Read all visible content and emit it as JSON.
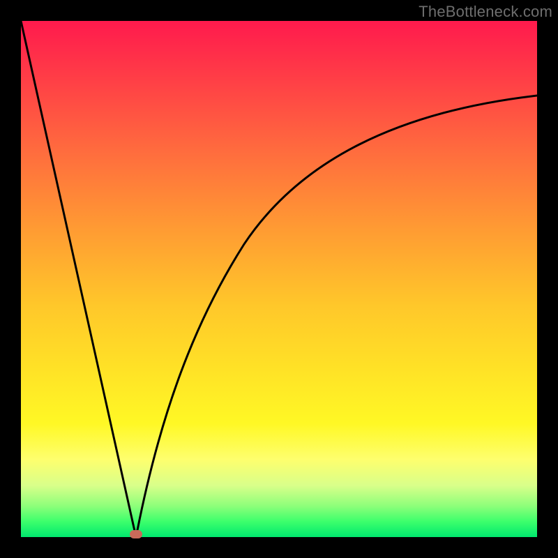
{
  "watermark": "TheBottleneck.com",
  "chart_data": {
    "type": "line",
    "title": "",
    "xlabel": "",
    "ylabel": "",
    "xlim": [
      0,
      100
    ],
    "ylim": [
      0,
      100
    ],
    "grid": false,
    "series": [
      {
        "name": "left-branch",
        "x": [
          0,
          22
        ],
        "y": [
          100,
          0
        ]
      },
      {
        "name": "right-branch",
        "x": [
          22,
          25,
          28,
          31,
          34,
          38,
          42,
          46,
          50,
          55,
          60,
          65,
          70,
          76,
          82,
          88,
          94,
          100
        ],
        "y": [
          0,
          12,
          22,
          30,
          37,
          44,
          50,
          55,
          59,
          63.5,
          67.5,
          71,
          74,
          77,
          79.5,
          81.8,
          83.8,
          85.5
        ]
      }
    ],
    "marker": {
      "x": 22,
      "y": 0,
      "color": "#c96a5a"
    },
    "background_gradient": {
      "top": "#ff1a4d",
      "mid": "#ffe326",
      "bottom": "#00e86e"
    }
  }
}
